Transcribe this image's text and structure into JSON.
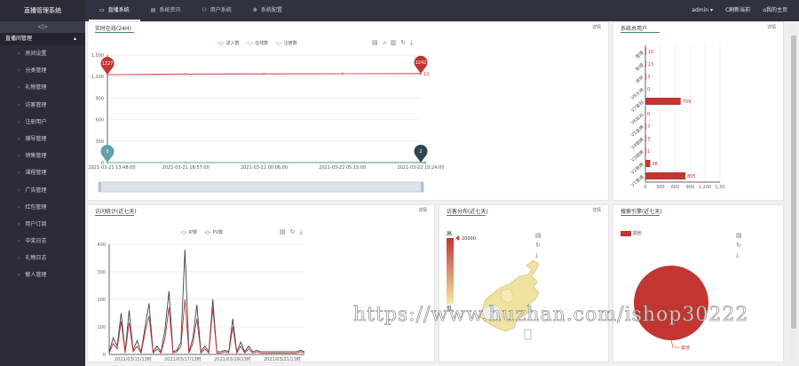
{
  "app": {
    "title": "直播管理系统"
  },
  "top_tabs": [
    {
      "label": "直播系统",
      "icon": "monitor-icon"
    },
    {
      "label": "系统资讯",
      "icon": "doc-icon"
    },
    {
      "label": "用户系统",
      "icon": "users-icon"
    },
    {
      "label": "系统配置",
      "icon": "gear-icon"
    }
  ],
  "right_nav": {
    "user": "admin ▾",
    "refresh": "C刷新当前",
    "home": "⌂我的主页"
  },
  "sidebar": {
    "toggle": "<|>",
    "group": "直播间管理",
    "items": [
      "房间设置",
      "分类管理",
      "礼物管理",
      "访客管理",
      "注册用户",
      "辅导管理",
      "销售管理",
      "课程管理",
      "广告管理",
      "红包管理",
      "用户订阅",
      "中奖日志",
      "礼物日志",
      "敏人管理"
    ]
  },
  "panels": {
    "online": {
      "title": "实时在线(24H)",
      "detail": "详情",
      "legend": [
        "进入数",
        "在线数",
        "注册数"
      ],
      "markers": {
        "start": "1227",
        "end": "1242",
        "zero_start": "0",
        "zero_end": "2",
        "end_label": "12",
        "zero_end_label": "0."
      }
    },
    "users": {
      "title": "系统总用户",
      "detail": "详情"
    },
    "visits": {
      "title": "访问统计(近七天)",
      "detail": "详情",
      "legend": [
        "IP数",
        "PV数"
      ]
    },
    "distribution": {
      "title": "访客分布(近七天)",
      "detail": "详情",
      "scale_high": "高",
      "scale_low": "低",
      "scale_max": "20000"
    },
    "search": {
      "title": "搜索引擎(近七天)",
      "legend": "其他",
      "slice_label": "其他"
    }
  },
  "watermark": "https://www.huzhan.com/ishop30222",
  "chart_data": [
    {
      "type": "line",
      "title": "实时在线(24H)",
      "x": [
        "2021-03-21 13:48:00",
        "2021-03-21 18:57:00",
        "2021-03-22 00:06:00",
        "2021-03-22 05:15:00",
        "2021-03-22 10:24:00"
      ],
      "ylim": [
        0,
        1500
      ],
      "yticks": [
        "0",
        "300",
        "600",
        "900",
        "1,200",
        "1,500"
      ],
      "series": [
        {
          "name": "进入数",
          "values": [
            1227,
            1235,
            1238,
            1240,
            1242
          ],
          "color": "#c23531"
        },
        {
          "name": "在线数",
          "values": [
            1225,
            1232,
            1236,
            1239,
            1241
          ],
          "color": "#d4676a"
        },
        {
          "name": "注册数",
          "values": [
            0,
            0,
            0,
            1,
            2
          ],
          "color": "#61a0a8"
        }
      ]
    },
    {
      "type": "bar",
      "title": "系统总用户",
      "orientation": "horizontal",
      "categories": [
        "V1普通",
        "V2铁牌",
        "V3铜牌",
        "V4银牌",
        "V5金牌",
        "V6钻石",
        "V7皇冠",
        "V8大神",
        "讲师",
        "助理",
        "管理"
      ],
      "values": [
        805,
        98,
        1,
        3,
        7,
        0,
        709,
        0,
        3,
        13,
        15
      ],
      "xlim": [
        0,
        1500
      ],
      "xticks": [
        "0",
        "300",
        "600",
        "900",
        "1,200",
        "1,50"
      ],
      "color": "#c23531"
    },
    {
      "type": "line",
      "title": "访问统计(近七天)",
      "x": [
        "2021/03/15/13时",
        "2021/03/17/13时",
        "2021/03/19/13时",
        "2021/03/21/13时"
      ],
      "ylim": [
        0,
        400
      ],
      "yticks": [
        "0",
        "100",
        "200",
        "300",
        "400"
      ],
      "series": [
        {
          "name": "IP数",
          "color": "#c23531",
          "values": [
            5,
            40,
            20,
            120,
            5,
            115,
            10,
            30,
            5,
            80,
            140,
            5,
            20,
            5,
            60,
            170,
            5,
            10,
            30,
            200,
            5,
            40,
            130,
            5,
            20,
            5,
            170,
            5,
            5,
            10,
            5,
            100,
            5,
            30,
            5,
            20,
            5,
            10,
            5,
            5,
            5,
            5,
            5,
            5,
            5,
            5,
            5,
            5,
            10,
            5
          ]
        },
        {
          "name": "PV数",
          "color": "#2f4554",
          "values": [
            10,
            60,
            30,
            150,
            10,
            160,
            15,
            50,
            10,
            100,
            185,
            10,
            30,
            10,
            90,
            230,
            10,
            15,
            45,
            380,
            10,
            60,
            180,
            10,
            30,
            10,
            200,
            10,
            10,
            15,
            10,
            130,
            10,
            45,
            10,
            30,
            10,
            15,
            10,
            10,
            10,
            10,
            10,
            10,
            10,
            10,
            10,
            10,
            15,
            10
          ]
        }
      ]
    },
    {
      "type": "pie",
      "title": "搜索引擎(近七天)",
      "slices": [
        {
          "name": "其他",
          "value": 100,
          "color": "#c23531"
        }
      ]
    }
  ]
}
